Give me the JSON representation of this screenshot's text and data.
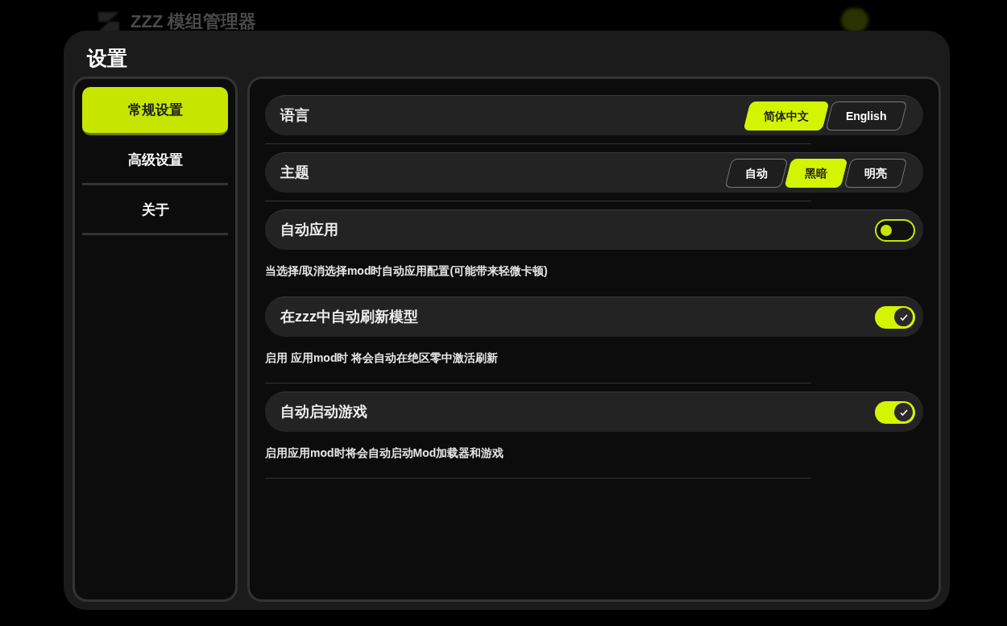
{
  "background": {
    "app_title": "ZZZ 模组管理器"
  },
  "dialog": {
    "title": "设置"
  },
  "sidebar": {
    "items": [
      {
        "label": "常规设置",
        "selected": true
      },
      {
        "label": "高级设置",
        "selected": false
      },
      {
        "label": "关于",
        "selected": false
      }
    ]
  },
  "settings": [
    {
      "kind": "choice",
      "label": "语言",
      "divider": true,
      "options": [
        {
          "label": "简体中文",
          "selected": true
        },
        {
          "label": "English",
          "selected": false
        }
      ]
    },
    {
      "kind": "choice",
      "label": "主题",
      "divider": true,
      "options": [
        {
          "label": "自动",
          "selected": false
        },
        {
          "label": "黑暗",
          "selected": true
        },
        {
          "label": "明亮",
          "selected": false
        }
      ]
    },
    {
      "kind": "toggle",
      "label": "自动应用",
      "on": false,
      "description": "当选择/取消选择mod时自动应用配置(可能带来轻微卡顿)",
      "divider": false
    },
    {
      "kind": "toggle",
      "label": "在zzz中自动刷新模型",
      "on": true,
      "description": "启用 应用mod时 将会自动在绝区零中激活刷新",
      "divider": true
    },
    {
      "kind": "toggle",
      "label": "自动启动游戏",
      "on": true,
      "description": "启用应用mod时将会自动启动Mod加载器和游戏",
      "divider": true
    }
  ]
}
